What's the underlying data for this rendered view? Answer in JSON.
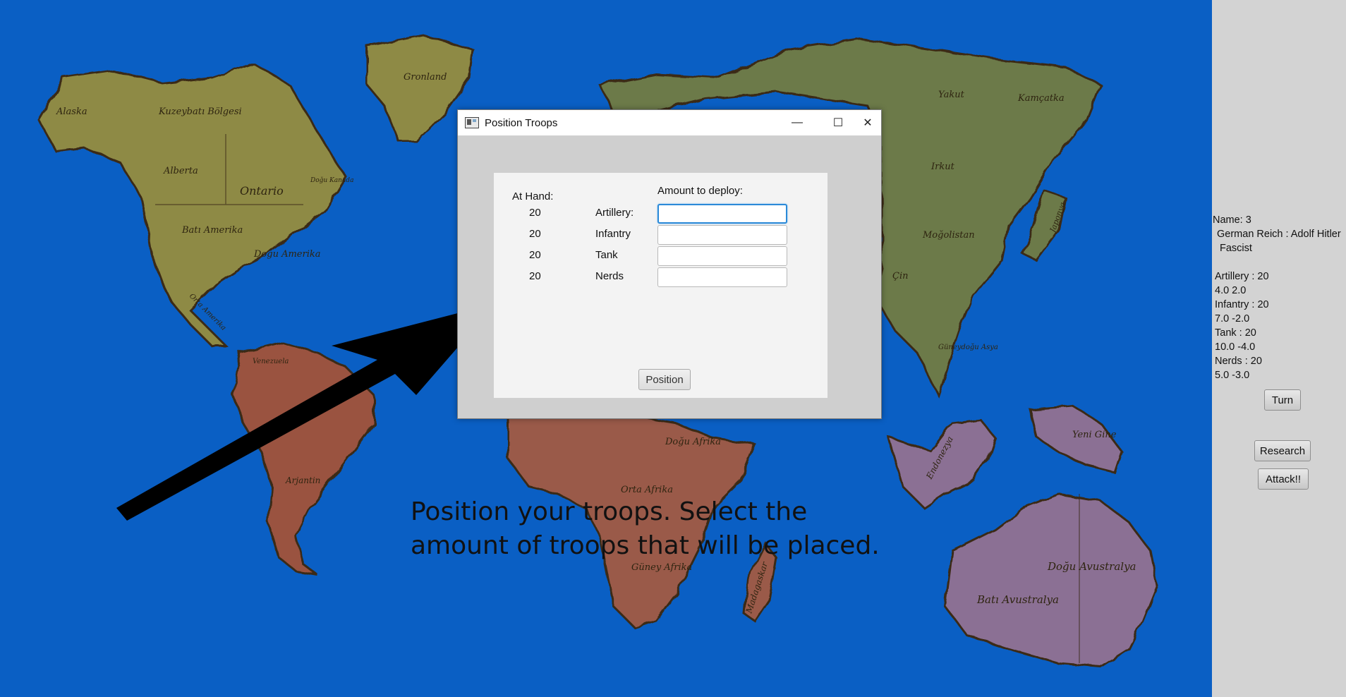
{
  "map": {
    "labels": [
      "Alaska",
      "Kuzeybatı Bölgesi",
      "Gronland",
      "Alberta",
      "Ontario",
      "Doğu Kanada",
      "Batı Amerika",
      "Doğu Amerika",
      "Orta Amerika",
      "Venezuela",
      "Arjantin",
      "Yakut",
      "Kamçatka",
      "Irkut",
      "Moğolistan",
      "Japonya",
      "Çin",
      "Güneydoğu Asya",
      "Yeni Gine",
      "Endonezya",
      "Doğu Afrika",
      "Orta Afrika",
      "Güney Afrika",
      "Madagaskar",
      "Doğu Avustralya",
      "Batı Avustralya"
    ]
  },
  "instruction": {
    "line1": "Position your troops. Select the",
    "line2": "amount of troops that will be placed."
  },
  "dialog": {
    "title": "Position Troops",
    "at_hand_header": "At Hand:",
    "amount_header": "Amount to deploy:",
    "rows": [
      {
        "count": "20",
        "unit": "Artillery:",
        "value": ""
      },
      {
        "count": "20",
        "unit": "Infantry",
        "value": ""
      },
      {
        "count": "20",
        "unit": "Tank",
        "value": ""
      },
      {
        "count": "20",
        "unit": "Nerds",
        "value": ""
      }
    ],
    "position_button": "Position",
    "controls": {
      "minimize": "—",
      "maximize": "☐",
      "close": "✕"
    }
  },
  "side_panel": {
    "name_line": "Name:  3",
    "nation_line": "German Reich :  Adolf Hitler",
    "ideology": "Fascist",
    "units": [
      {
        "line": "Artillery  :  20",
        "stats": "4.0 2.0"
      },
      {
        "line": "Infantry  :  20",
        "stats": "7.0 -2.0"
      },
      {
        "line": "Tank  :  20",
        "stats": "10.0 -4.0"
      },
      {
        "line": "Nerds  :  20",
        "stats": "5.0 -3.0"
      }
    ],
    "turn_button": "Turn",
    "research_button": "Research",
    "attack_button": "Attack!!"
  },
  "colors": {
    "ocean": "#0a5fc4",
    "north_america": "#8e8a44",
    "south_america": "#9a5240",
    "africa": "#9a5a4a",
    "asia": "#6c7a4a",
    "oceania": "#8b6f94",
    "side_panel": "#d3d3d3"
  }
}
